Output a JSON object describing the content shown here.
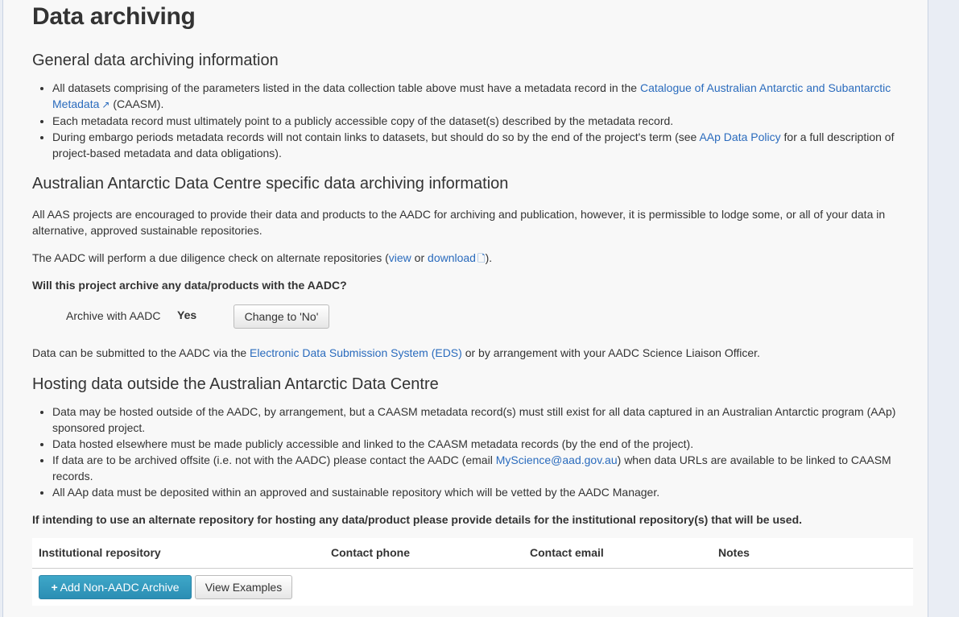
{
  "page_title": "Data archiving",
  "general": {
    "heading": "General data archiving information",
    "b1_text": "All datasets comprising of the parameters listed in the data collection table above must have a metadata record in the ",
    "b1_link": "Catalogue of Australian Antarctic and Subantarctic Metadata",
    "b1_suffix": "(CAASM).",
    "b2_text": "Each metadata record must ultimately point to a publicly accessible copy of the dataset(s) described by the metadata record.",
    "b3_text": "During embargo periods metadata records will not contain links to datasets, but should do so by the end of the project's term (see ",
    "b3_link": "AAp Data Policy",
    "b3_suffix": " for a full description of project-based metadata and data obligations)."
  },
  "aadc": {
    "heading": "Australian Antarctic Data Centre specific data archiving information",
    "para1": "All AAS projects are encouraged to provide their data and products to the AADC for archiving and publication, however, it is permissible to lodge some, or all of your data in alternative, approved sustainable repositories.",
    "para2_pre": "The AADC will perform a due diligence check on alternate repositories (",
    "view_link": "view",
    "para2_or": " or ",
    "download_link": "download",
    "para2_post": ").",
    "question": "Will this project archive any data/products with the AADC?",
    "archive_label": "Archive with AADC",
    "archive_value": "Yes",
    "change_button": "Change to 'No'",
    "submit_pre": "Data can be submitted to the AADC via the ",
    "eds_link": "Electronic Data Submission System (EDS)",
    "submit_post": " or by arrangement with your AADC Science Liaison Officer."
  },
  "hosting": {
    "heading": "Hosting data outside the Australian Antarctic Data Centre",
    "b1_text": "Data may be hosted outside of the AADC, by arrangement, but a CAASM metadata record(s) must still exist for all data captured in an Australian Antarctic program (AAp) sponsored project.",
    "b2_text": "Data hosted elsewhere must be made publicly accessible and linked to the CAASM metadata records (by the end of the project).",
    "b3_pre": "If data are to be archived offsite (i.e. not with the AADC) please contact the AADC (email ",
    "b3_link": "MyScience@aad.gov.au",
    "b3_post": ") when data URLs are available to be linked to CAASM records.",
    "b4_text": "All AAp data must be deposited within an approved and sustainable repository which will be vetted by the AADC Manager.",
    "instruction": "If intending to use an alternate repository for hosting any data/product please provide details for the institutional repository(s) that will be used."
  },
  "table": {
    "columns": [
      "Institutional repository",
      "Contact phone",
      "Contact email",
      "Notes"
    ],
    "add_button": "Add Non-AADC Archive",
    "view_button": "View Examples"
  },
  "icons": {
    "external_link": "external-link-icon",
    "download": "file-icon",
    "plus": "plus-icon"
  },
  "colors": {
    "link": "#2a6bbd",
    "primary_button": "#2b8eb4"
  }
}
